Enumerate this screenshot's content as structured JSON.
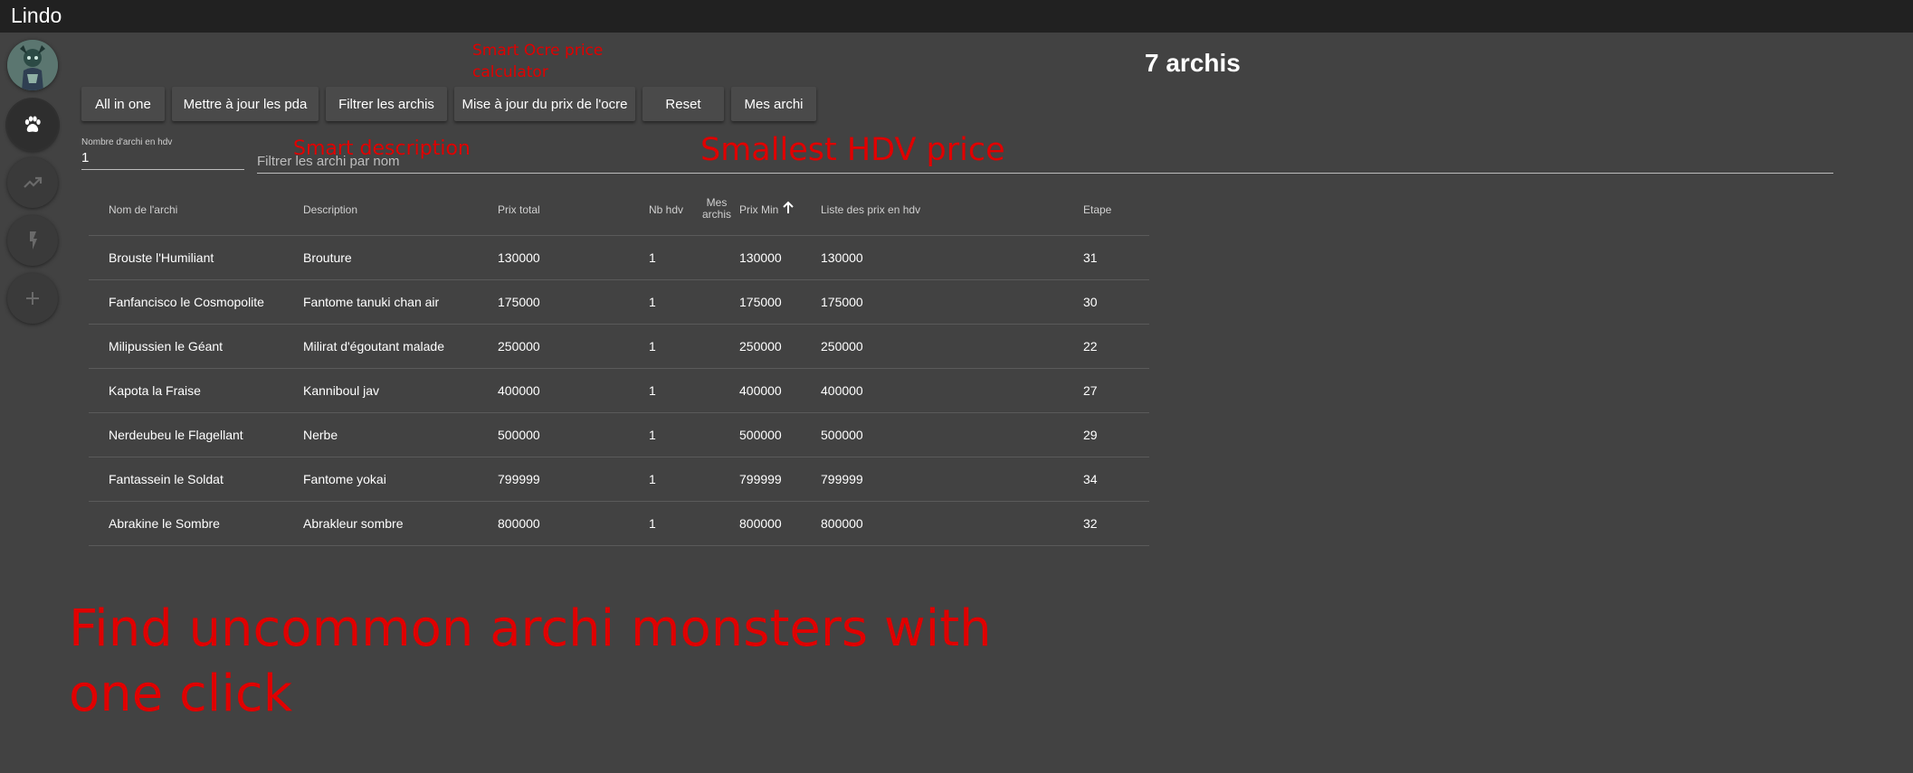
{
  "app": {
    "title": "Lindo"
  },
  "sidebar": {
    "items": [
      {
        "name": "avatar"
      },
      {
        "name": "paw-icon",
        "active": true
      },
      {
        "name": "trending-up-icon"
      },
      {
        "name": "lightning-icon"
      },
      {
        "name": "plus-icon"
      }
    ]
  },
  "header": {
    "count_title": "7 archis"
  },
  "toolbar": {
    "buttons": [
      "All in one",
      "Mettre à jour les pda",
      "Filtrer les archis",
      "Mise à jour du prix de l'ocre",
      "Reset",
      "Mes archi"
    ]
  },
  "filters": {
    "count_label": "Nombre d'archi en hdv",
    "count_value": "1",
    "name_placeholder": "Filtrer les archi par nom"
  },
  "table": {
    "headers": {
      "name": "Nom de l'archi",
      "description": "Description",
      "total": "Prix total",
      "nb_hdv": "Nb hdv",
      "mes_archis_1": "Mes",
      "mes_archis_2": "archis",
      "min_price": "Prix Min",
      "price_list": "Liste des prix en hdv",
      "step": "Etape"
    },
    "sort": {
      "column": "Prix Min",
      "direction": "ascending"
    },
    "rows": [
      {
        "name": "Brouste l'Humiliant",
        "description": "Brouture",
        "total": "130000",
        "nb_hdv": "1",
        "min": "130000",
        "prices": "130000",
        "step": "31"
      },
      {
        "name": "Fanfancisco le Cosmopolite",
        "description": "Fantome tanuki chan air",
        "total": "175000",
        "nb_hdv": "1",
        "min": "175000",
        "prices": "175000",
        "step": "30"
      },
      {
        "name": "Milipussien le Géant",
        "description": "Milirat d'égoutant malade",
        "total": "250000",
        "nb_hdv": "1",
        "min": "250000",
        "prices": "250000",
        "step": "22"
      },
      {
        "name": "Kapota la Fraise",
        "description": "Kanniboul jav",
        "total": "400000",
        "nb_hdv": "1",
        "min": "400000",
        "prices": "400000",
        "step": "27"
      },
      {
        "name": "Nerdeubeu le Flagellant",
        "description": "Nerbe",
        "total": "500000",
        "nb_hdv": "1",
        "min": "500000",
        "prices": "500000",
        "step": "29"
      },
      {
        "name": "Fantassein le Soldat",
        "description": "Fantome yokai",
        "total": "799999",
        "nb_hdv": "1",
        "min": "799999",
        "prices": "799999",
        "step": "34"
      },
      {
        "name": "Abrakine le Sombre",
        "description": "Abrakleur sombre",
        "total": "800000",
        "nb_hdv": "1",
        "min": "800000",
        "prices": "800000",
        "step": "32"
      }
    ]
  },
  "annotations": {
    "ocre": "Smart Ocre price calculator",
    "description": "Smart description",
    "hdv": "Smallest HDV price",
    "find": "Find uncommon archi monsters with one click"
  },
  "colors": {
    "background": "#424242",
    "titlebar": "#212121",
    "annotation": "#e00000"
  }
}
